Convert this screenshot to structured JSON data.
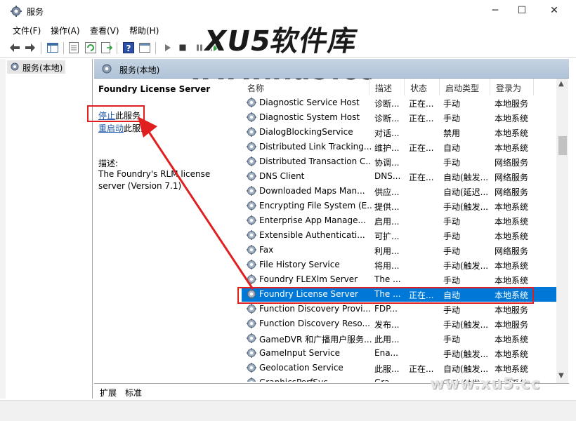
{
  "window": {
    "title": "服务",
    "minimize_glyph": "─",
    "maximize_glyph": "☐",
    "close_glyph": "✕"
  },
  "menu": [
    "文件(F)",
    "操作(A)",
    "查看(V)",
    "帮助(H)"
  ],
  "toolbar": {
    "icons": [
      "back-icon",
      "forward-icon",
      "show-hide-tree-icon",
      "properties-icon",
      "refresh-icon",
      "export-list-icon",
      "help-icon",
      "console-icon",
      "start-icon",
      "stop-icon",
      "pause-icon",
      "resume-icon"
    ]
  },
  "watermarks": {
    "brand": "XU5软件库",
    "url": "www.xu5.cc",
    "corner_url": "www.xu5.cc"
  },
  "tree": {
    "root": "服务(本地)"
  },
  "header": {
    "title": "服务(本地)"
  },
  "detail": {
    "service_name": "Foundry License Server",
    "stop_link": "停止",
    "stop_suffix": "此服务",
    "restart_link": "重启动",
    "restart_suffix": "此服务",
    "desc_label": "描述:",
    "desc_text": "The Foundry's RLM license server (Version 7.1)"
  },
  "columns": [
    "名称",
    "描述",
    "状态",
    "启动类型",
    "登录为"
  ],
  "services": [
    {
      "name": "Diagnostic Service Host",
      "desc": "诊断...",
      "status": "正在...",
      "start": "手动",
      "logon": "本地服务"
    },
    {
      "name": "Diagnostic System Host",
      "desc": "诊断...",
      "status": "正在...",
      "start": "手动",
      "logon": "本地系统"
    },
    {
      "name": "DialogBlockingService",
      "desc": "对话...",
      "status": "",
      "start": "禁用",
      "logon": "本地系统"
    },
    {
      "name": "Distributed Link Tracking...",
      "desc": "维护...",
      "status": "正在...",
      "start": "自动",
      "logon": "本地系统"
    },
    {
      "name": "Distributed Transaction C...",
      "desc": "协调...",
      "status": "",
      "start": "手动",
      "logon": "网络服务"
    },
    {
      "name": "DNS Client",
      "desc": "DNS...",
      "status": "正在...",
      "start": "自动(触发...",
      "logon": "网络服务"
    },
    {
      "name": "Downloaded Maps Man...",
      "desc": "供应...",
      "status": "",
      "start": "自动(延迟...",
      "logon": "网络服务"
    },
    {
      "name": "Encrypting File System (E...",
      "desc": "提供...",
      "status": "",
      "start": "手动(触发...",
      "logon": "本地系统"
    },
    {
      "name": "Enterprise App Manage...",
      "desc": "启用...",
      "status": "",
      "start": "手动",
      "logon": "本地系统"
    },
    {
      "name": "Extensible Authenticati...",
      "desc": "可扩...",
      "status": "",
      "start": "手动",
      "logon": "本地系统"
    },
    {
      "name": "Fax",
      "desc": "利用...",
      "status": "",
      "start": "手动",
      "logon": "网络服务"
    },
    {
      "name": "File History Service",
      "desc": "将用...",
      "status": "",
      "start": "手动(触发...",
      "logon": "本地系统"
    },
    {
      "name": "Foundry FLEXlm Server",
      "desc": "The ...",
      "status": "",
      "start": "手动",
      "logon": "本地系统"
    },
    {
      "name": "Foundry License Server",
      "desc": "The ...",
      "status": "正在...",
      "start": "自动",
      "logon": "本地系统",
      "selected": true
    },
    {
      "name": "Function Discovery Provi...",
      "desc": "FDP...",
      "status": "",
      "start": "手动",
      "logon": "本地服务"
    },
    {
      "name": "Function Discovery Reso...",
      "desc": "发布...",
      "status": "",
      "start": "手动(触发...",
      "logon": "本地服务"
    },
    {
      "name": "GameDVR 和广播用户服务...",
      "desc": "此用...",
      "status": "",
      "start": "手动",
      "logon": "本地系统"
    },
    {
      "name": "GameInput Service",
      "desc": "Ena...",
      "status": "",
      "start": "手动(触发...",
      "logon": "本地系统"
    },
    {
      "name": "Geolocation Service",
      "desc": "此服...",
      "status": "正在...",
      "start": "自动(触发...",
      "logon": "本地系统"
    },
    {
      "name": "GraphicsPerfSvc",
      "desc": "Gra...",
      "status": "",
      "start": "手动(触发...",
      "logon": "本地系统"
    }
  ],
  "tabs": [
    "扩展",
    "标准"
  ],
  "scroll": {
    "up": "▲",
    "down": "▼"
  },
  "colors": {
    "selection": "#0078d7",
    "highlight_box": "#e02020",
    "header_bar": "#c6d4e3"
  }
}
